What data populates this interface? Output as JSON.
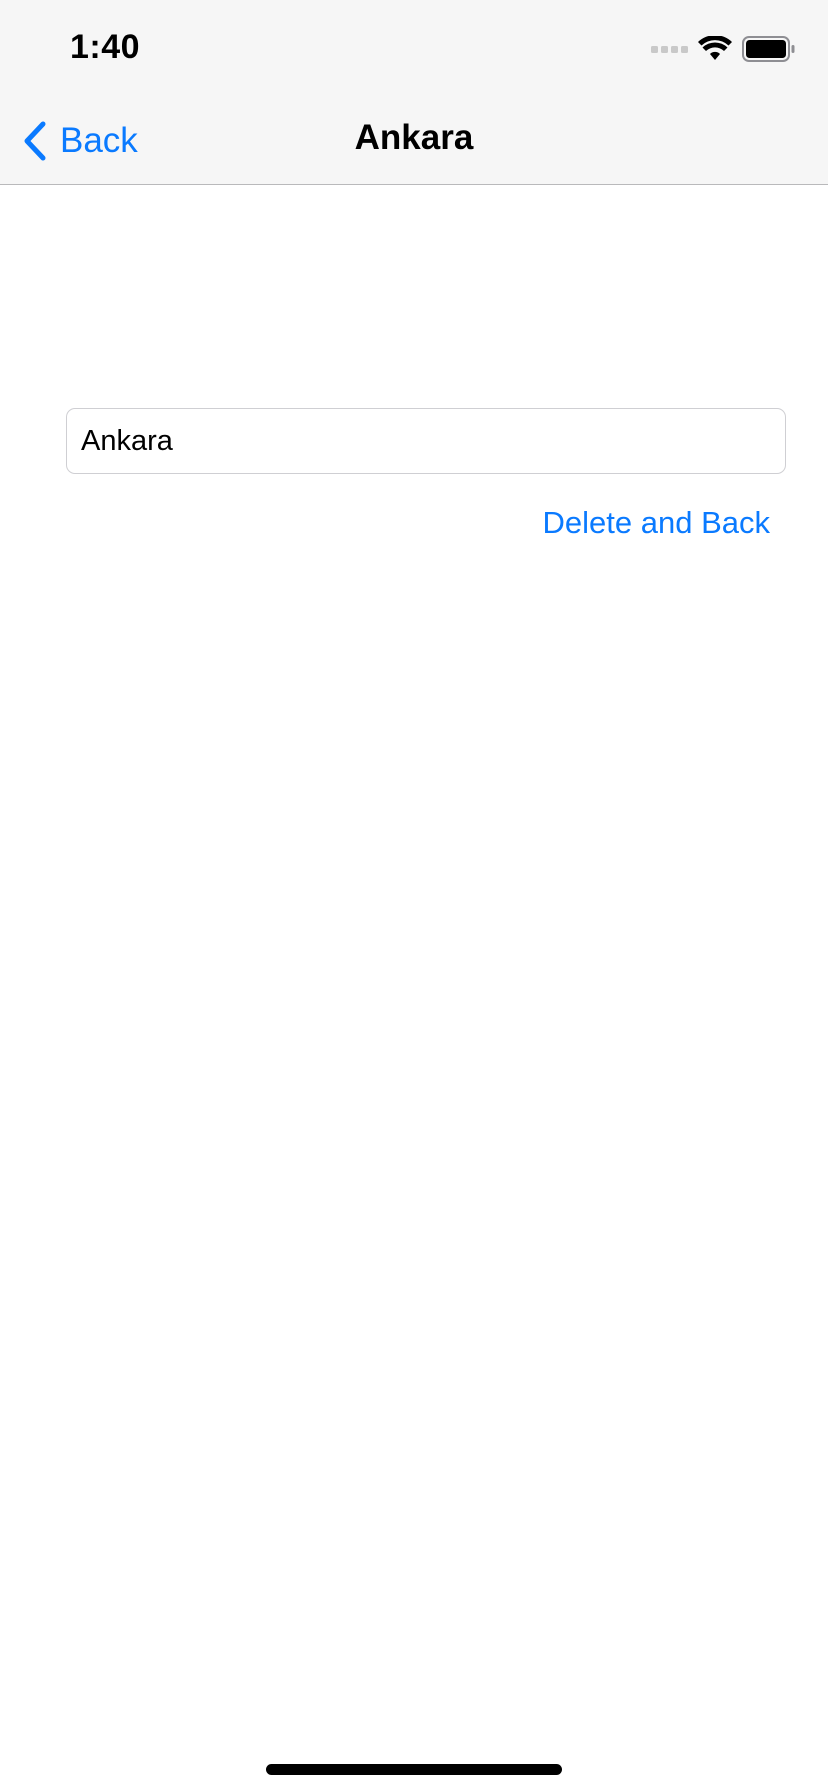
{
  "status_bar": {
    "time": "1:40",
    "icons": [
      "signal-icon",
      "wifi-icon",
      "battery-icon"
    ]
  },
  "nav_bar": {
    "back_label": "Back",
    "title": "Ankara",
    "back_icon": "chevron-left-icon"
  },
  "form": {
    "city_field": {
      "value": "Ankara",
      "placeholder": ""
    },
    "delete_button_label": "Delete and Back"
  },
  "colors": {
    "accent": "#0a7aff",
    "nav_background": "#f6f6f6",
    "field_border": "#cfcfd3",
    "text": "#000000"
  }
}
